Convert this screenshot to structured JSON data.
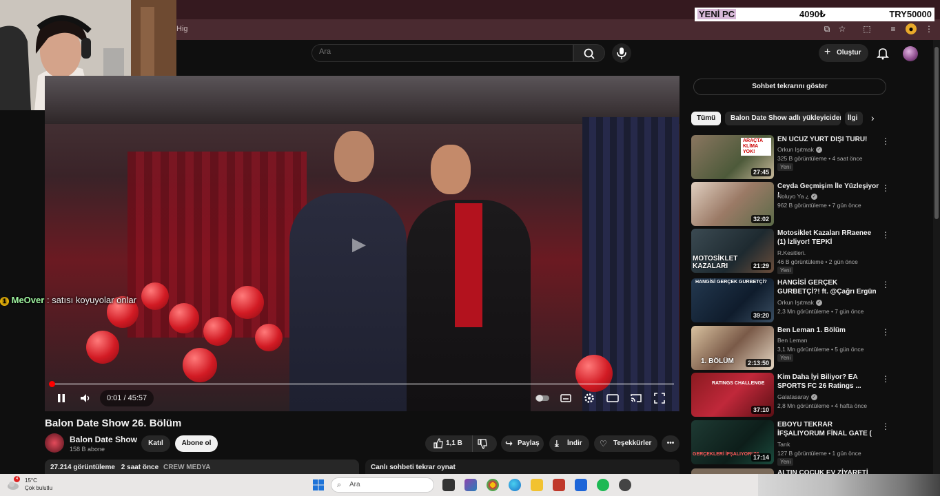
{
  "overlay": {
    "promo": {
      "label": "YENİ PC",
      "price": "4090₺",
      "goal": "TRY50000"
    },
    "chat_message": {
      "badge": "1",
      "user": "MeOver",
      "text": " : satısı koyuyolar onlar"
    }
  },
  "browser": {
    "address_fragment": "Hig"
  },
  "header": {
    "search_placeholder": "Ara",
    "create_label": "Oluştur"
  },
  "player": {
    "time": "0:01 / 45:57",
    "progress_fraction": 0.0004
  },
  "video": {
    "title": "Balon Date Show 26. Bölüm",
    "channel": "Balon Date Show",
    "subscribers": "158 B abone",
    "join_label": "Katıl",
    "subscribe_label": "Abone ol",
    "likes": "1,1 B",
    "share_label": "Paylaş",
    "download_label": "İndir",
    "thanks_label": "Teşekkürler",
    "views": "27.214 görüntüleme",
    "age": "2 saat önce",
    "tag": "CREW MEDYA",
    "chat_replay_label": "Canlı sohbeti tekrar oynat"
  },
  "sidebar": {
    "show_chat_label": "Sohbet tekrarını göster",
    "chips": [
      "Tümü",
      "Balon Date Show adlı yükleyiciden",
      "İlgi"
    ],
    "recommendations": [
      {
        "title": "EN UCUZ YURT DIŞI TURU!",
        "channel": "Orkun Işıtmak",
        "meta": "325 B görüntüleme • 4 saat önce",
        "badge": "Yeni",
        "duration": "27:45",
        "thumb_text": "ARAÇTA KLİMA YOK!",
        "verified": true
      },
      {
        "title": "Ceyda Geçmişim İle Yüzleşiyor !",
        "channel": "Noluyo Ya ¿",
        "meta": "962 B görüntüleme • 7 gün önce",
        "badge": "",
        "duration": "32:02",
        "thumb_text": "",
        "verified": true
      },
      {
        "title": "Motosiklet Kazaları RRaenee (1) İzliyor! TEPKİ",
        "channel": "R.Kesitleri.",
        "meta": "46 B görüntüleme • 2 gün önce",
        "badge": "Yeni",
        "duration": "21:29",
        "thumb_text": "MOTOSİKLET KAZALARI",
        "verified": false
      },
      {
        "title": "HANGİSİ GERÇEK GURBETÇİ?! ft. @Çağrı Ergün",
        "channel": "Orkun Işıtmak",
        "meta": "2,3 Mn görüntüleme • 7 gün önce",
        "badge": "",
        "duration": "39:20",
        "thumb_text": "HANGİSİ GERÇEK GURBETÇİ?",
        "verified": true
      },
      {
        "title": "Ben Leman 1. Bölüm",
        "channel": "Ben Leman",
        "meta": "3,1 Mn görüntüleme • 5 gün önce",
        "badge": "Yeni",
        "duration": "2:13:50",
        "thumb_text": "1. BÖLÜM",
        "verified": false
      },
      {
        "title": "Kim Daha İyi Biliyor? EA SPORTS FC 26 Ratings ...",
        "channel": "Galatasaray",
        "meta": "2,8 Mn görüntüleme • 4 hafta önce",
        "badge": "",
        "duration": "37:10",
        "thumb_text": "RATINGS CHALLENGE",
        "verified": true
      },
      {
        "title": "EBOYU TEKRAR İFŞALIYORUM FİNAL GATE ( SİLİNMEDEN İZ...",
        "channel": "Tarık",
        "meta": "127 B görüntüleme • 1 gün önce",
        "badge": "Yeni",
        "duration": "17:14",
        "thumb_text": "GERÇEKLERİ İFŞALIYORUM",
        "verified": false
      },
      {
        "title": "ALTIN ÇOCUK EV ZİYARETİ",
        "channel": "",
        "meta": "",
        "badge": "",
        "duration": "",
        "thumb_text": "",
        "verified": false
      }
    ]
  },
  "taskbar": {
    "weather_temp": "15°C",
    "weather_desc": "Çok bulutlu",
    "weather_badge": "4",
    "search_placeholder": "Ara"
  },
  "colors": {
    "accent": "#ff0000",
    "background": "#0f0f0f",
    "chip_bg": "#272727"
  }
}
